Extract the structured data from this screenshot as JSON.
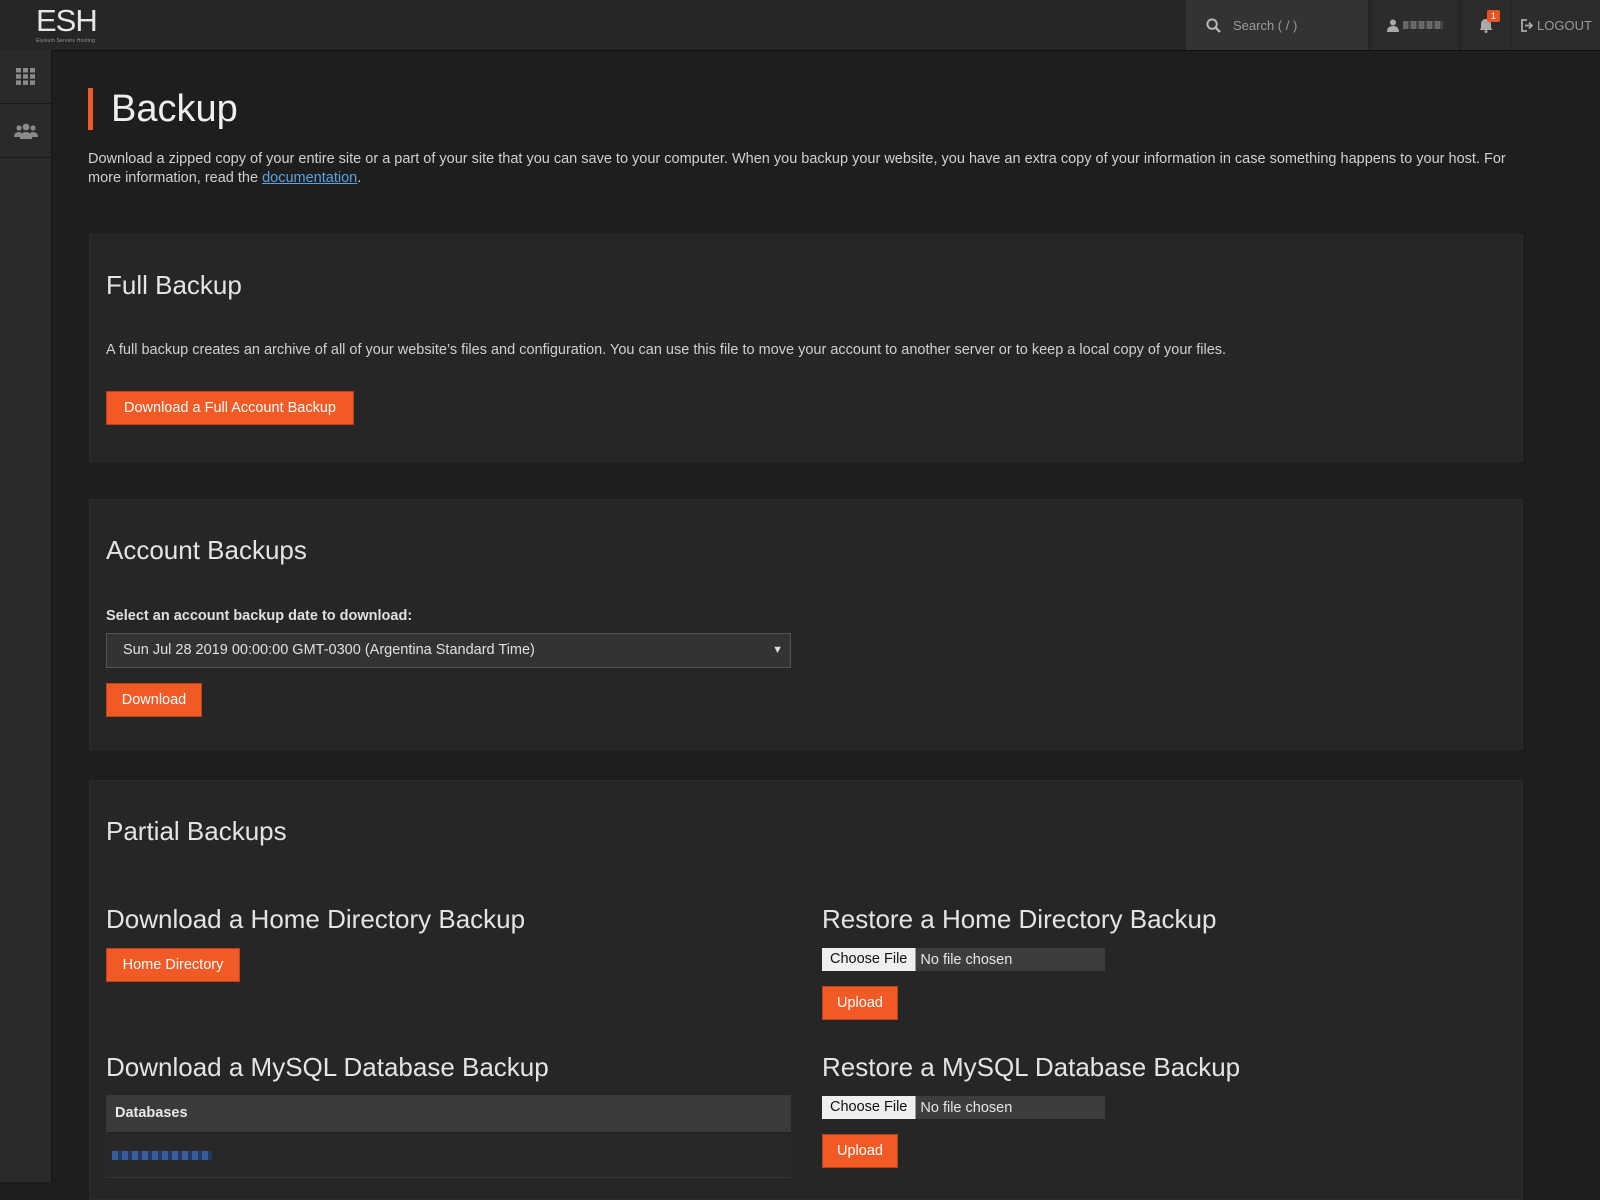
{
  "header": {
    "logo_text": "ESH",
    "logo_subtext": "Elysium Servers Hosting",
    "search_placeholder": "Search ( / )",
    "notification_count": "1",
    "logout_label": "LOGOUT"
  },
  "sidebar": {
    "items": [
      {
        "name": "apps-grid-icon"
      },
      {
        "name": "users-icon"
      }
    ]
  },
  "page": {
    "title": "Backup",
    "intro_before": "Download a zipped copy of your entire site or a part of your site that you can save to your computer. When you backup your website, you have an extra copy of your information in case something happens to your host. For more information, read the ",
    "intro_link": "documentation",
    "intro_after": "."
  },
  "full_backup": {
    "title": "Full Backup",
    "description": "A full backup creates an archive of all of your website’s files and configuration. You can use this file to move your account to another server or to keep a local copy of your files.",
    "button_label": "Download a Full Account Backup"
  },
  "account_backups": {
    "title": "Account Backups",
    "select_label": "Select an account backup date to download:",
    "selected_date": "Sun Jul 28 2019 00:00:00 GMT-0300 (Argentina Standard Time)",
    "download_label": "Download"
  },
  "partial_backups": {
    "title": "Partial Backups",
    "home_download_title": "Download a Home Directory Backup",
    "home_button": "Home Directory",
    "home_restore_title": "Restore a Home Directory Backup",
    "mysql_download_title": "Download a MySQL Database Backup",
    "mysql_restore_title": "Restore a MySQL Database Backup",
    "choose_file_label": "Choose File",
    "no_file_label": "No file chosen",
    "upload_label": "Upload",
    "databases_header": "Databases"
  },
  "colors": {
    "accent": "#f15a24",
    "link": "#5aa3e0",
    "background": "#1e1e1e",
    "panel": "#262626"
  }
}
